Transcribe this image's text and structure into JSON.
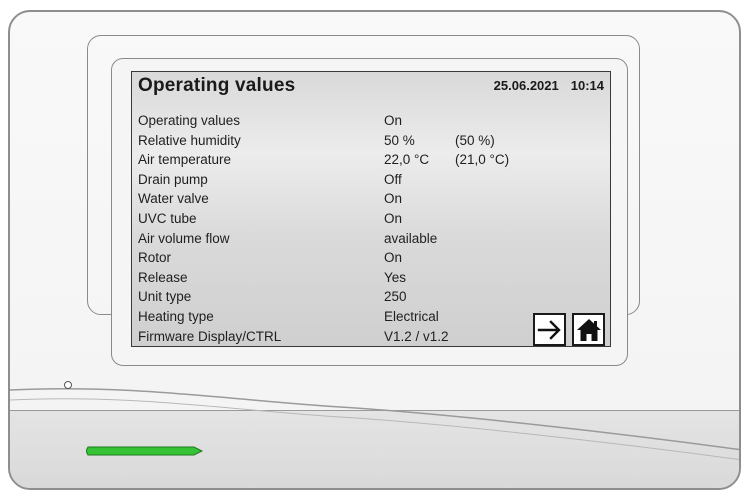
{
  "screen": {
    "title": "Operating values",
    "date": "25.06.2021",
    "time": "10:14",
    "rows": [
      {
        "label": "Operating values",
        "value": "On",
        "extra": ""
      },
      {
        "label": "Relative humidity",
        "value": "50 %",
        "extra": "(50 %)"
      },
      {
        "label": "Air temperature",
        "value": "22,0 °C",
        "extra": "(21,0 °C)"
      },
      {
        "label": "Drain pump",
        "value": "Off",
        "extra": ""
      },
      {
        "label": "Water valve",
        "value": "On",
        "extra": ""
      },
      {
        "label": "UVC tube",
        "value": "On",
        "extra": ""
      },
      {
        "label": "Air volume flow",
        "value": "available",
        "extra": ""
      },
      {
        "label": "Rotor",
        "value": "On",
        "extra": ""
      },
      {
        "label": "Release",
        "value": "Yes",
        "extra": ""
      },
      {
        "label": "Unit type",
        "value": "250",
        "extra": ""
      },
      {
        "label": "Heating type",
        "value": "Electrical",
        "extra": ""
      },
      {
        "label": "Firmware Display/CTRL",
        "value": "V1.2  / v1.2",
        "extra": ""
      }
    ],
    "buttons": {
      "next_icon": "arrow-right-icon",
      "home_icon": "home-icon"
    }
  },
  "device": {
    "status_led_color": "#35c235"
  }
}
